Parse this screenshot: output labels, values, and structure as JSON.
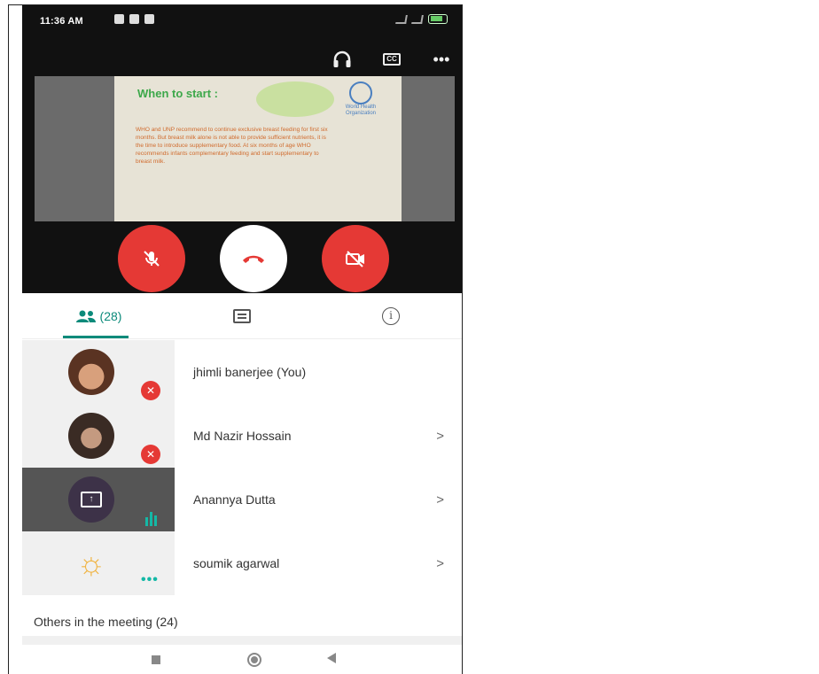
{
  "statusbar": {
    "time": "11:36 AM"
  },
  "call": {
    "tools": [
      "headphones-icon",
      "captions-icon",
      "more-icon"
    ],
    "captions_label": "CC",
    "more_label": "•••",
    "slide": {
      "title": "When to start :",
      "logo_text": "World Health Organization",
      "body": "WHO and UNP recommend to continue exclusive breast feeding for first six months. But breast milk alone is not able to provide sufficient nutrients, it is the time to introduce supplementary food. At six months of age WHO recommends infants complementary feeding and start supplementary to breast milk."
    },
    "controls": {
      "mic": "mic-off-icon",
      "end": "end-call-icon",
      "camera": "camera-off-icon"
    }
  },
  "tabs": {
    "people_label": "(28)",
    "chat": "chat-icon",
    "info": "info-icon"
  },
  "participants": [
    {
      "name": "jhimli banerjee (You)",
      "status": "muted",
      "has_chevron": false
    },
    {
      "name": "Md Nazir Hossain",
      "status": "muted",
      "has_chevron": true
    },
    {
      "name": "Anannya Dutta",
      "status": "presenting",
      "has_chevron": true
    },
    {
      "name": "soumik agarwal",
      "status": "more",
      "has_chevron": true
    }
  ],
  "chevron": ">",
  "others_label": "Others in the meeting (24)",
  "colors": {
    "accent": "#0b8a7a",
    "danger": "#e53935",
    "speaking": "#14b8a6"
  }
}
